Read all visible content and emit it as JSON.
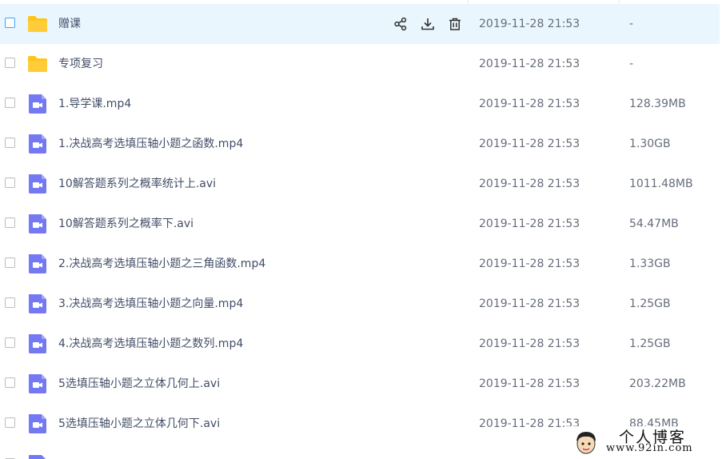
{
  "colors": {
    "hover_row": "#e9f6fe",
    "folder": "#ffc519",
    "video": "#7478f2",
    "checkbox_active": "#3aa4f8",
    "text": "#424e67",
    "meta_text": "#666d7a"
  },
  "row_actions": [
    {
      "name": "share",
      "icon": "share-icon"
    },
    {
      "name": "download",
      "icon": "download-icon"
    },
    {
      "name": "delete",
      "icon": "trash-icon"
    }
  ],
  "files": [
    {
      "name": "赠课",
      "type": "folder",
      "icon": "folder-icon",
      "modified": "2019-11-28 21:53",
      "size": "-",
      "hover": true
    },
    {
      "name": "专项复习",
      "type": "folder",
      "icon": "folder-icon",
      "modified": "2019-11-28 21:53",
      "size": "-"
    },
    {
      "name": "1.导学课.mp4",
      "type": "video",
      "icon": "video-file-icon",
      "modified": "2019-11-28 21:53",
      "size": "128.39MB"
    },
    {
      "name": "1.决战高考选填压轴小题之函数.mp4",
      "type": "video",
      "icon": "video-file-icon",
      "modified": "2019-11-28 21:53",
      "size": "1.30GB"
    },
    {
      "name": "10解答题系列之概率统计上.avi",
      "type": "video",
      "icon": "video-file-icon",
      "modified": "2019-11-28 21:53",
      "size": "1011.48MB"
    },
    {
      "name": "10解答题系列之概率下.avi",
      "type": "video",
      "icon": "video-file-icon",
      "modified": "2019-11-28 21:53",
      "size": "54.47MB"
    },
    {
      "name": "2.决战高考选填压轴小题之三角函数.mp4",
      "type": "video",
      "icon": "video-file-icon",
      "modified": "2019-11-28 21:53",
      "size": "1.33GB"
    },
    {
      "name": "3.决战高考选填压轴小题之向量.mp4",
      "type": "video",
      "icon": "video-file-icon",
      "modified": "2019-11-28 21:53",
      "size": "1.25GB"
    },
    {
      "name": "4.决战高考选填压轴小题之数列.mp4",
      "type": "video",
      "icon": "video-file-icon",
      "modified": "2019-11-28 21:53",
      "size": "1.25GB"
    },
    {
      "name": "5选填压轴小题之立体几何上.avi",
      "type": "video",
      "icon": "video-file-icon",
      "modified": "2019-11-28 21:53",
      "size": "203.22MB"
    },
    {
      "name": "5选填压轴小题之立体几何下.avi",
      "type": "video",
      "icon": "video-file-icon",
      "modified": "2019-11-28 21:53",
      "size": "88.45MB"
    }
  ],
  "watermark": {
    "title": "个人博客",
    "url": "www.92in.com"
  }
}
